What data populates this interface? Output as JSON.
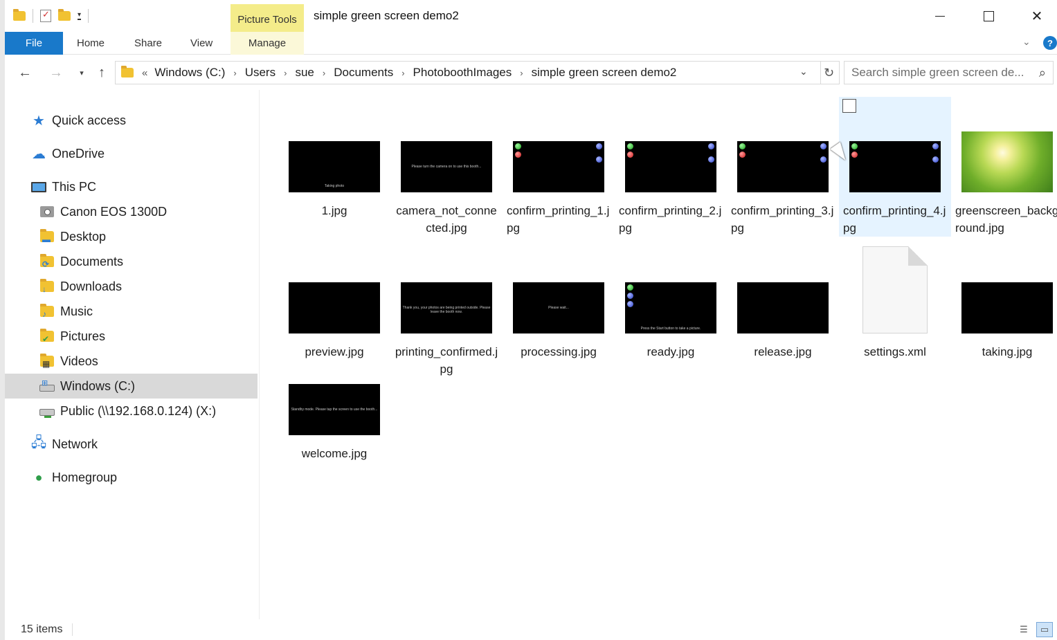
{
  "window": {
    "title": "simple green screen demo2",
    "contextual_tab": "Picture Tools"
  },
  "ribbon": {
    "tabs": [
      "File",
      "Home",
      "Share",
      "View",
      "Manage"
    ]
  },
  "address": {
    "lead": "«",
    "crumbs": [
      "Windows (C:)",
      "Users",
      "sue",
      "Documents",
      "PhotoboothImages",
      "simple green screen demo2"
    ]
  },
  "search": {
    "placeholder": "Search simple green screen de..."
  },
  "navpane": {
    "items": [
      {
        "label": "Quick access",
        "icon": "star-icon"
      },
      {
        "label": "OneDrive",
        "icon": "cloud-icon"
      },
      {
        "label": "This PC",
        "icon": "computer-icon"
      },
      {
        "label": "Canon EOS 1300D",
        "icon": "camera-icon"
      },
      {
        "label": "Desktop",
        "icon": "folder-icon"
      },
      {
        "label": "Documents",
        "icon": "folder-icon"
      },
      {
        "label": "Downloads",
        "icon": "folder-icon"
      },
      {
        "label": "Music",
        "icon": "folder-icon"
      },
      {
        "label": "Pictures",
        "icon": "folder-icon"
      },
      {
        "label": "Videos",
        "icon": "folder-icon"
      },
      {
        "label": "Windows (C:)",
        "icon": "drive-icon"
      },
      {
        "label": "Public (\\\\192.168.0.124) (X:)",
        "icon": "network-drive-icon"
      },
      {
        "label": "Network",
        "icon": "network-icon"
      },
      {
        "label": "Homegroup",
        "icon": "homegroup-icon"
      }
    ],
    "selected": "Windows (C:)"
  },
  "files": [
    {
      "name": "1.jpg",
      "caption": "Taking photo"
    },
    {
      "name": "camera_not_connected.jpg",
      "caption": "Please turn the camera on to use this booth..."
    },
    {
      "name": "confirm_printing_1.jpg",
      "caption": ""
    },
    {
      "name": "confirm_printing_2.jpg",
      "caption": ""
    },
    {
      "name": "confirm_printing_3.jpg",
      "caption": ""
    },
    {
      "name": "confirm_printing_4.jpg",
      "caption": ""
    },
    {
      "name": "greenscreen_background.jpg",
      "caption": ""
    },
    {
      "name": "preview.jpg",
      "caption": ""
    },
    {
      "name": "printing_confirmed.jpg",
      "caption": "Thank you, your photos are being printed outside. Please leave the booth now."
    },
    {
      "name": "processing.jpg",
      "caption": "Please wait..."
    },
    {
      "name": "ready.jpg",
      "caption": "Press the Start button to take a picture."
    },
    {
      "name": "release.jpg",
      "caption": ""
    },
    {
      "name": "settings.xml",
      "caption": ""
    },
    {
      "name": "taking.jpg",
      "caption": ""
    },
    {
      "name": "welcome.jpg",
      "caption": "Standby mode. Please tap the screen to use the booth..."
    }
  ],
  "status": {
    "count": "15 items"
  },
  "colors": {
    "file_tab": "#1979ca",
    "picture_tools": "#f4ec8a",
    "selection": "#e5f3ff",
    "nav_selected": "#d9d9d9"
  }
}
